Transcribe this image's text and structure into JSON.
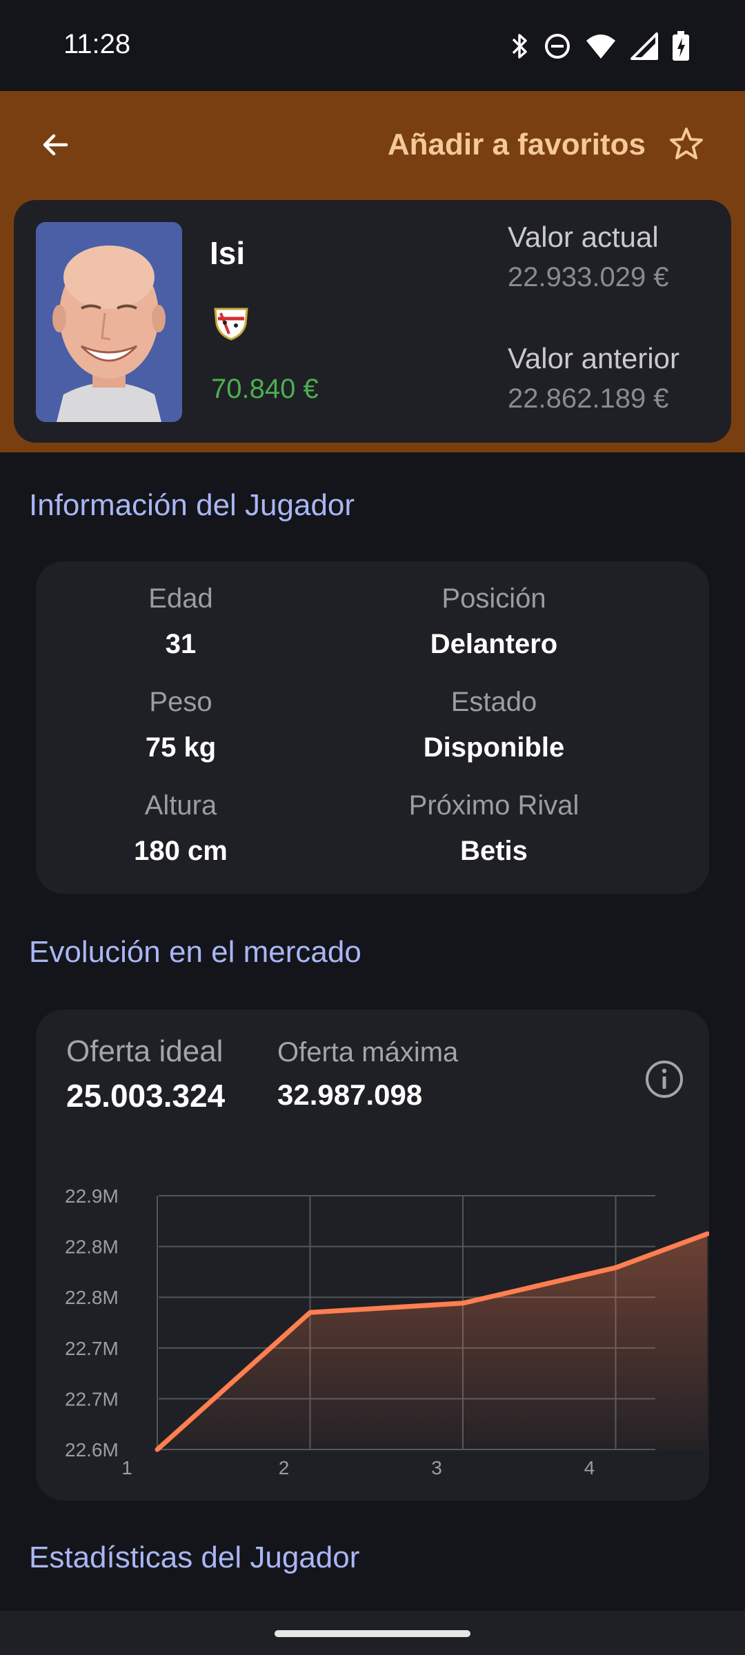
{
  "status_bar": {
    "time": "11:28"
  },
  "header": {
    "favorite_label": "Añadir a favoritos"
  },
  "player": {
    "name": "Isi",
    "price": "70.840 €",
    "current_value_label": "Valor actual",
    "current_value": "22.933.029 €",
    "previous_value_label": "Valor anterior",
    "previous_value": "22.862.189 €"
  },
  "sections": {
    "info_title": "Información del Jugador",
    "market_title": "Evolución en el mercado",
    "stats_title": "Estadísticas del Jugador"
  },
  "info": [
    {
      "label": "Edad",
      "value": "31"
    },
    {
      "label": "Posición",
      "value": "Delantero"
    },
    {
      "label": "Peso",
      "value": "75 kg"
    },
    {
      "label": "Estado",
      "value": "Disponible"
    },
    {
      "label": "Altura",
      "value": "180 cm"
    },
    {
      "label": "Próximo Rival",
      "value": "Betis"
    }
  ],
  "market": {
    "ideal_label": "Oferta ideal",
    "ideal_value": "25.003.324",
    "max_label": "Oferta máxima",
    "max_value": "32.987.098"
  },
  "colors": {
    "header": "#7a3f10",
    "accent_line": "#ff7f50",
    "section_title": "#a9b6f5",
    "price_green": "#4caf50"
  },
  "chart_data": {
    "type": "area",
    "x": [
      1,
      2,
      3,
      4,
      4.6
    ],
    "values": [
      22600000,
      22762000,
      22773000,
      22815000,
      22855000
    ],
    "xticks": [
      "1",
      "2",
      "3",
      "4"
    ],
    "yticks": [
      "22.6M",
      "22.7M",
      "22.7M",
      "22.8M",
      "22.8M",
      "22.9M"
    ],
    "ylim": [
      22600000,
      22900000
    ],
    "grid": true
  }
}
